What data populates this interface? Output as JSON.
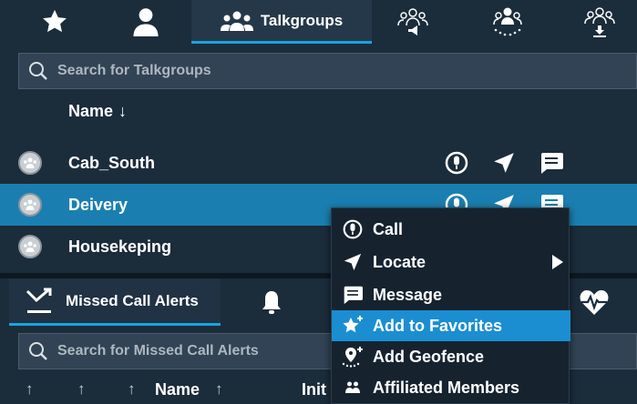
{
  "top_tabs": {
    "talkgroups_label": "Talkgroups"
  },
  "talkgroups_search": {
    "placeholder": "Search for Talkgroups"
  },
  "list": {
    "column_header": "Name",
    "sort_indicator": "↓",
    "rows": [
      {
        "label": "Cab_South",
        "selected": false
      },
      {
        "label": "Deivery",
        "selected": true
      },
      {
        "label": "Housekeping",
        "selected": false
      }
    ]
  },
  "bottom_panel": {
    "missed_calls_tab_label": "Missed Call Alerts",
    "search_placeholder": "Search for Missed Call Alerts",
    "header": {
      "sort_arrow_1": "↑",
      "sort_arrow_2": "↑",
      "sort_arrow_3": "↑",
      "name_label": "Name",
      "name_sort": "↑",
      "init_label": "Init"
    }
  },
  "context_menu": {
    "items": [
      {
        "label": "Call",
        "icon": "call-icon"
      },
      {
        "label": "Locate",
        "icon": "locate-arrow-icon",
        "has_submenu": true
      },
      {
        "label": "Message",
        "icon": "message-icon"
      },
      {
        "label": "Add to Favorites",
        "icon": "star-plus-icon",
        "highlighted": true
      },
      {
        "label": "Add Geofence",
        "icon": "geofence-icon"
      },
      {
        "label": "Affiliated Members",
        "icon": "members-icon"
      }
    ]
  },
  "colors": {
    "background": "#1b2c3b",
    "accent": "#1aa3de",
    "selected_row": "#1a7fb0",
    "menu_highlight": "#1b8ed1"
  }
}
